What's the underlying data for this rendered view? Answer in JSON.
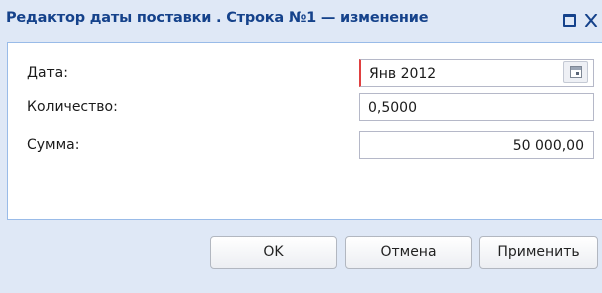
{
  "window": {
    "title": "Редактор даты поставки . Строка №1 — изменение"
  },
  "form": {
    "fields": [
      {
        "label": "Дата:",
        "value": "Янв 2012",
        "trigger_icon": "calendar-icon"
      },
      {
        "label": "Количество:",
        "value": "0,5000"
      },
      {
        "label": "Сумма:",
        "value": "50 000,00"
      }
    ]
  },
  "buttons": {
    "ok": "OK",
    "cancel": "Отмена",
    "apply": "Применить"
  }
}
